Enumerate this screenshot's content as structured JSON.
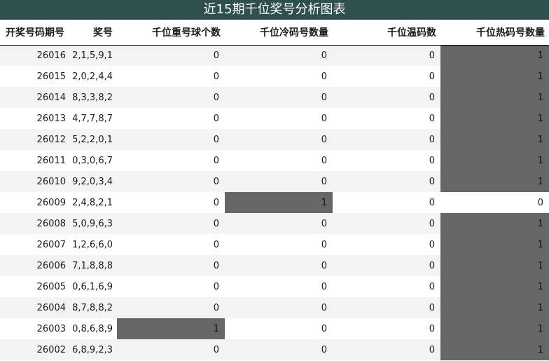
{
  "title": "近15期千位奖号分析图表",
  "columns": [
    "开奖号码期号",
    "奖号",
    "千位重号球个数",
    "千位冷码号数量",
    "千位温码数",
    "千位热码号数量"
  ],
  "highlight_color": "#666666",
  "rows": [
    {
      "issue": "26016",
      "numbers": "2,1,5,9,1",
      "repeat": "0",
      "cold": "0",
      "warm": "0",
      "hot": "1",
      "hl": [
        5
      ]
    },
    {
      "issue": "26015",
      "numbers": "2,0,2,4,4",
      "repeat": "0",
      "cold": "0",
      "warm": "0",
      "hot": "1",
      "hl": [
        5
      ]
    },
    {
      "issue": "26014",
      "numbers": "8,3,3,8,2",
      "repeat": "0",
      "cold": "0",
      "warm": "0",
      "hot": "1",
      "hl": [
        5
      ]
    },
    {
      "issue": "26013",
      "numbers": "4,7,7,8,7",
      "repeat": "0",
      "cold": "0",
      "warm": "0",
      "hot": "1",
      "hl": [
        5
      ]
    },
    {
      "issue": "26012",
      "numbers": "5,2,2,0,1",
      "repeat": "0",
      "cold": "0",
      "warm": "0",
      "hot": "1",
      "hl": [
        5
      ]
    },
    {
      "issue": "26011",
      "numbers": "0,3,0,6,7",
      "repeat": "0",
      "cold": "0",
      "warm": "0",
      "hot": "1",
      "hl": [
        5
      ]
    },
    {
      "issue": "26010",
      "numbers": "9,2,0,3,4",
      "repeat": "0",
      "cold": "0",
      "warm": "0",
      "hot": "1",
      "hl": [
        5
      ]
    },
    {
      "issue": "26009",
      "numbers": "2,4,8,2,1",
      "repeat": "0",
      "cold": "1",
      "warm": "0",
      "hot": "0",
      "hl": [
        3
      ]
    },
    {
      "issue": "26008",
      "numbers": "5,0,9,6,3",
      "repeat": "0",
      "cold": "0",
      "warm": "0",
      "hot": "1",
      "hl": [
        5
      ]
    },
    {
      "issue": "26007",
      "numbers": "1,2,6,6,0",
      "repeat": "0",
      "cold": "0",
      "warm": "0",
      "hot": "1",
      "hl": [
        5
      ]
    },
    {
      "issue": "26006",
      "numbers": "7,1,8,8,8",
      "repeat": "0",
      "cold": "0",
      "warm": "0",
      "hot": "1",
      "hl": [
        5
      ]
    },
    {
      "issue": "26005",
      "numbers": "0,6,1,6,9",
      "repeat": "0",
      "cold": "0",
      "warm": "0",
      "hot": "1",
      "hl": [
        5
      ]
    },
    {
      "issue": "26004",
      "numbers": "8,7,8,8,2",
      "repeat": "0",
      "cold": "0",
      "warm": "0",
      "hot": "1",
      "hl": [
        5
      ]
    },
    {
      "issue": "26003",
      "numbers": "0,8,6,8,9",
      "repeat": "1",
      "cold": "0",
      "warm": "0",
      "hot": "1",
      "hl": [
        2,
        5
      ]
    },
    {
      "issue": "26002",
      "numbers": "6,8,9,2,3",
      "repeat": "0",
      "cold": "0",
      "warm": "0",
      "hot": "1",
      "hl": [
        5
      ]
    }
  ]
}
